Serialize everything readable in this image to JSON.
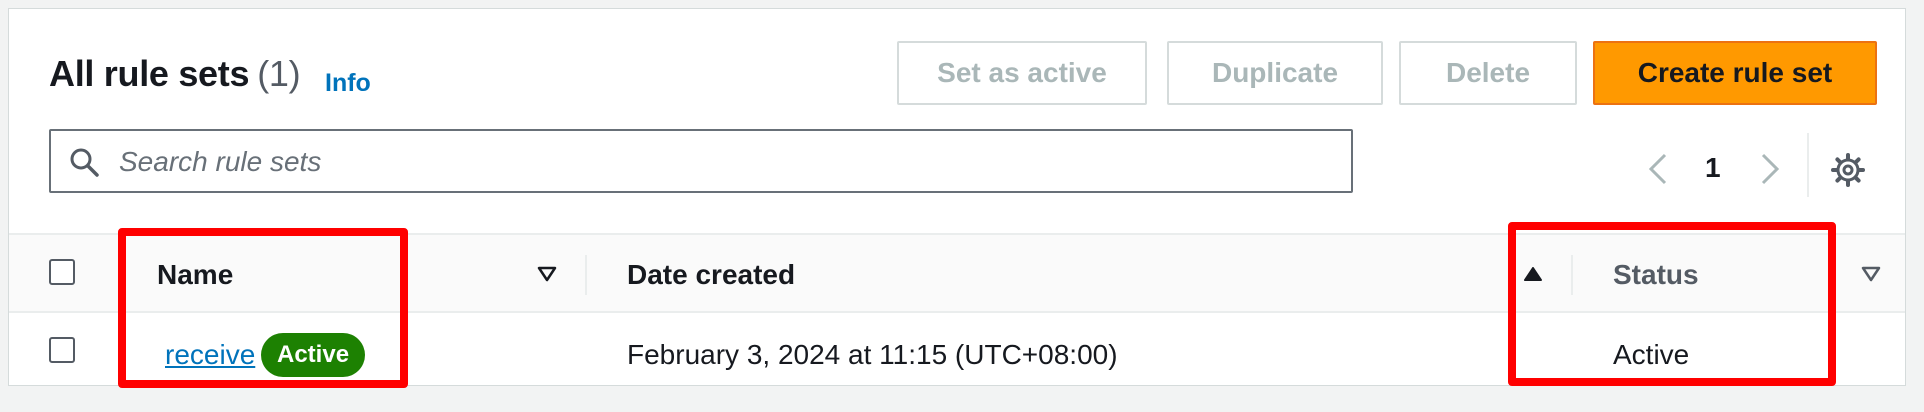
{
  "header": {
    "title": "All rule sets",
    "count": "(1)",
    "info_link": "Info"
  },
  "actions": {
    "set_active": "Set as active",
    "duplicate": "Duplicate",
    "delete": "Delete",
    "create": "Create rule set"
  },
  "search": {
    "placeholder": "Search rule sets",
    "value": ""
  },
  "pagination": {
    "current_page": "1"
  },
  "table": {
    "columns": {
      "name": "Name",
      "date_created": "Date created",
      "status": "Status"
    },
    "sort": {
      "column": "Date created",
      "direction": "ascending"
    },
    "rows": [
      {
        "name": "receive",
        "badge": "Active",
        "date_created": "February 3, 2024 at 11:15 (UTC+08:00)",
        "status": "Active"
      }
    ]
  },
  "colors": {
    "primary_button": "#ff9900",
    "link": "#0073bb",
    "active_badge": "#1d8102",
    "highlight": "#ff0000"
  },
  "icons": [
    "search-icon",
    "chevron-left-icon",
    "chevron-right-icon",
    "settings-icon",
    "sort-down-icon",
    "sort-up-icon"
  ]
}
